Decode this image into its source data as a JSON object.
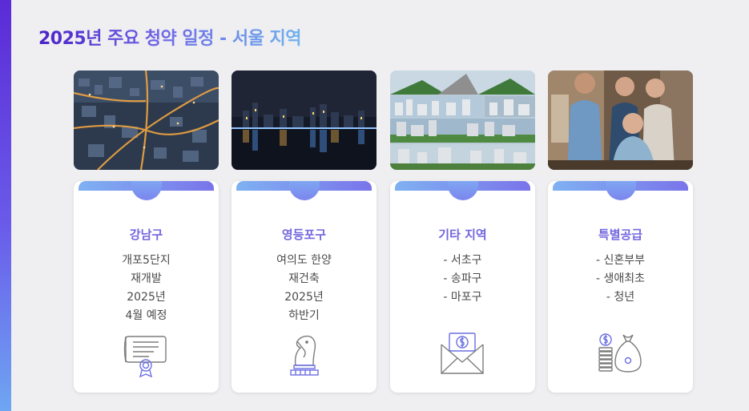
{
  "slide": {
    "title": "2025년 주요 청약 일정 - 서울 지역"
  },
  "photos": [
    {
      "icon": "aerial-city-photo"
    },
    {
      "icon": "night-skyline-photo"
    },
    {
      "icon": "city-collage-photo"
    },
    {
      "icon": "people-group-photo"
    }
  ],
  "cards": [
    {
      "title": "강남구",
      "lines": [
        "개포5단지",
        "재개발",
        "2025년",
        "4월 예정"
      ],
      "icon": "certificate-icon"
    },
    {
      "title": "영등포구",
      "lines": [
        "여의도 한양",
        "재건축",
        "2025년",
        "하반기"
      ],
      "icon": "chess-knight-icon"
    },
    {
      "title": "기타 지역",
      "lines": [
        "- 서초구",
        "- 송파구",
        "- 마포구"
      ],
      "icon": "money-envelope-icon"
    },
    {
      "title": "특별공급",
      "lines": [
        "- 신혼부부",
        "- 생애최초",
        "- 청년"
      ],
      "icon": "coins-moneybag-icon"
    }
  ],
  "colors": {
    "accent": "#7267de",
    "gradient_start": "#4b22c8",
    "gradient_end": "#6fb2ee",
    "background": "#efeff1"
  }
}
